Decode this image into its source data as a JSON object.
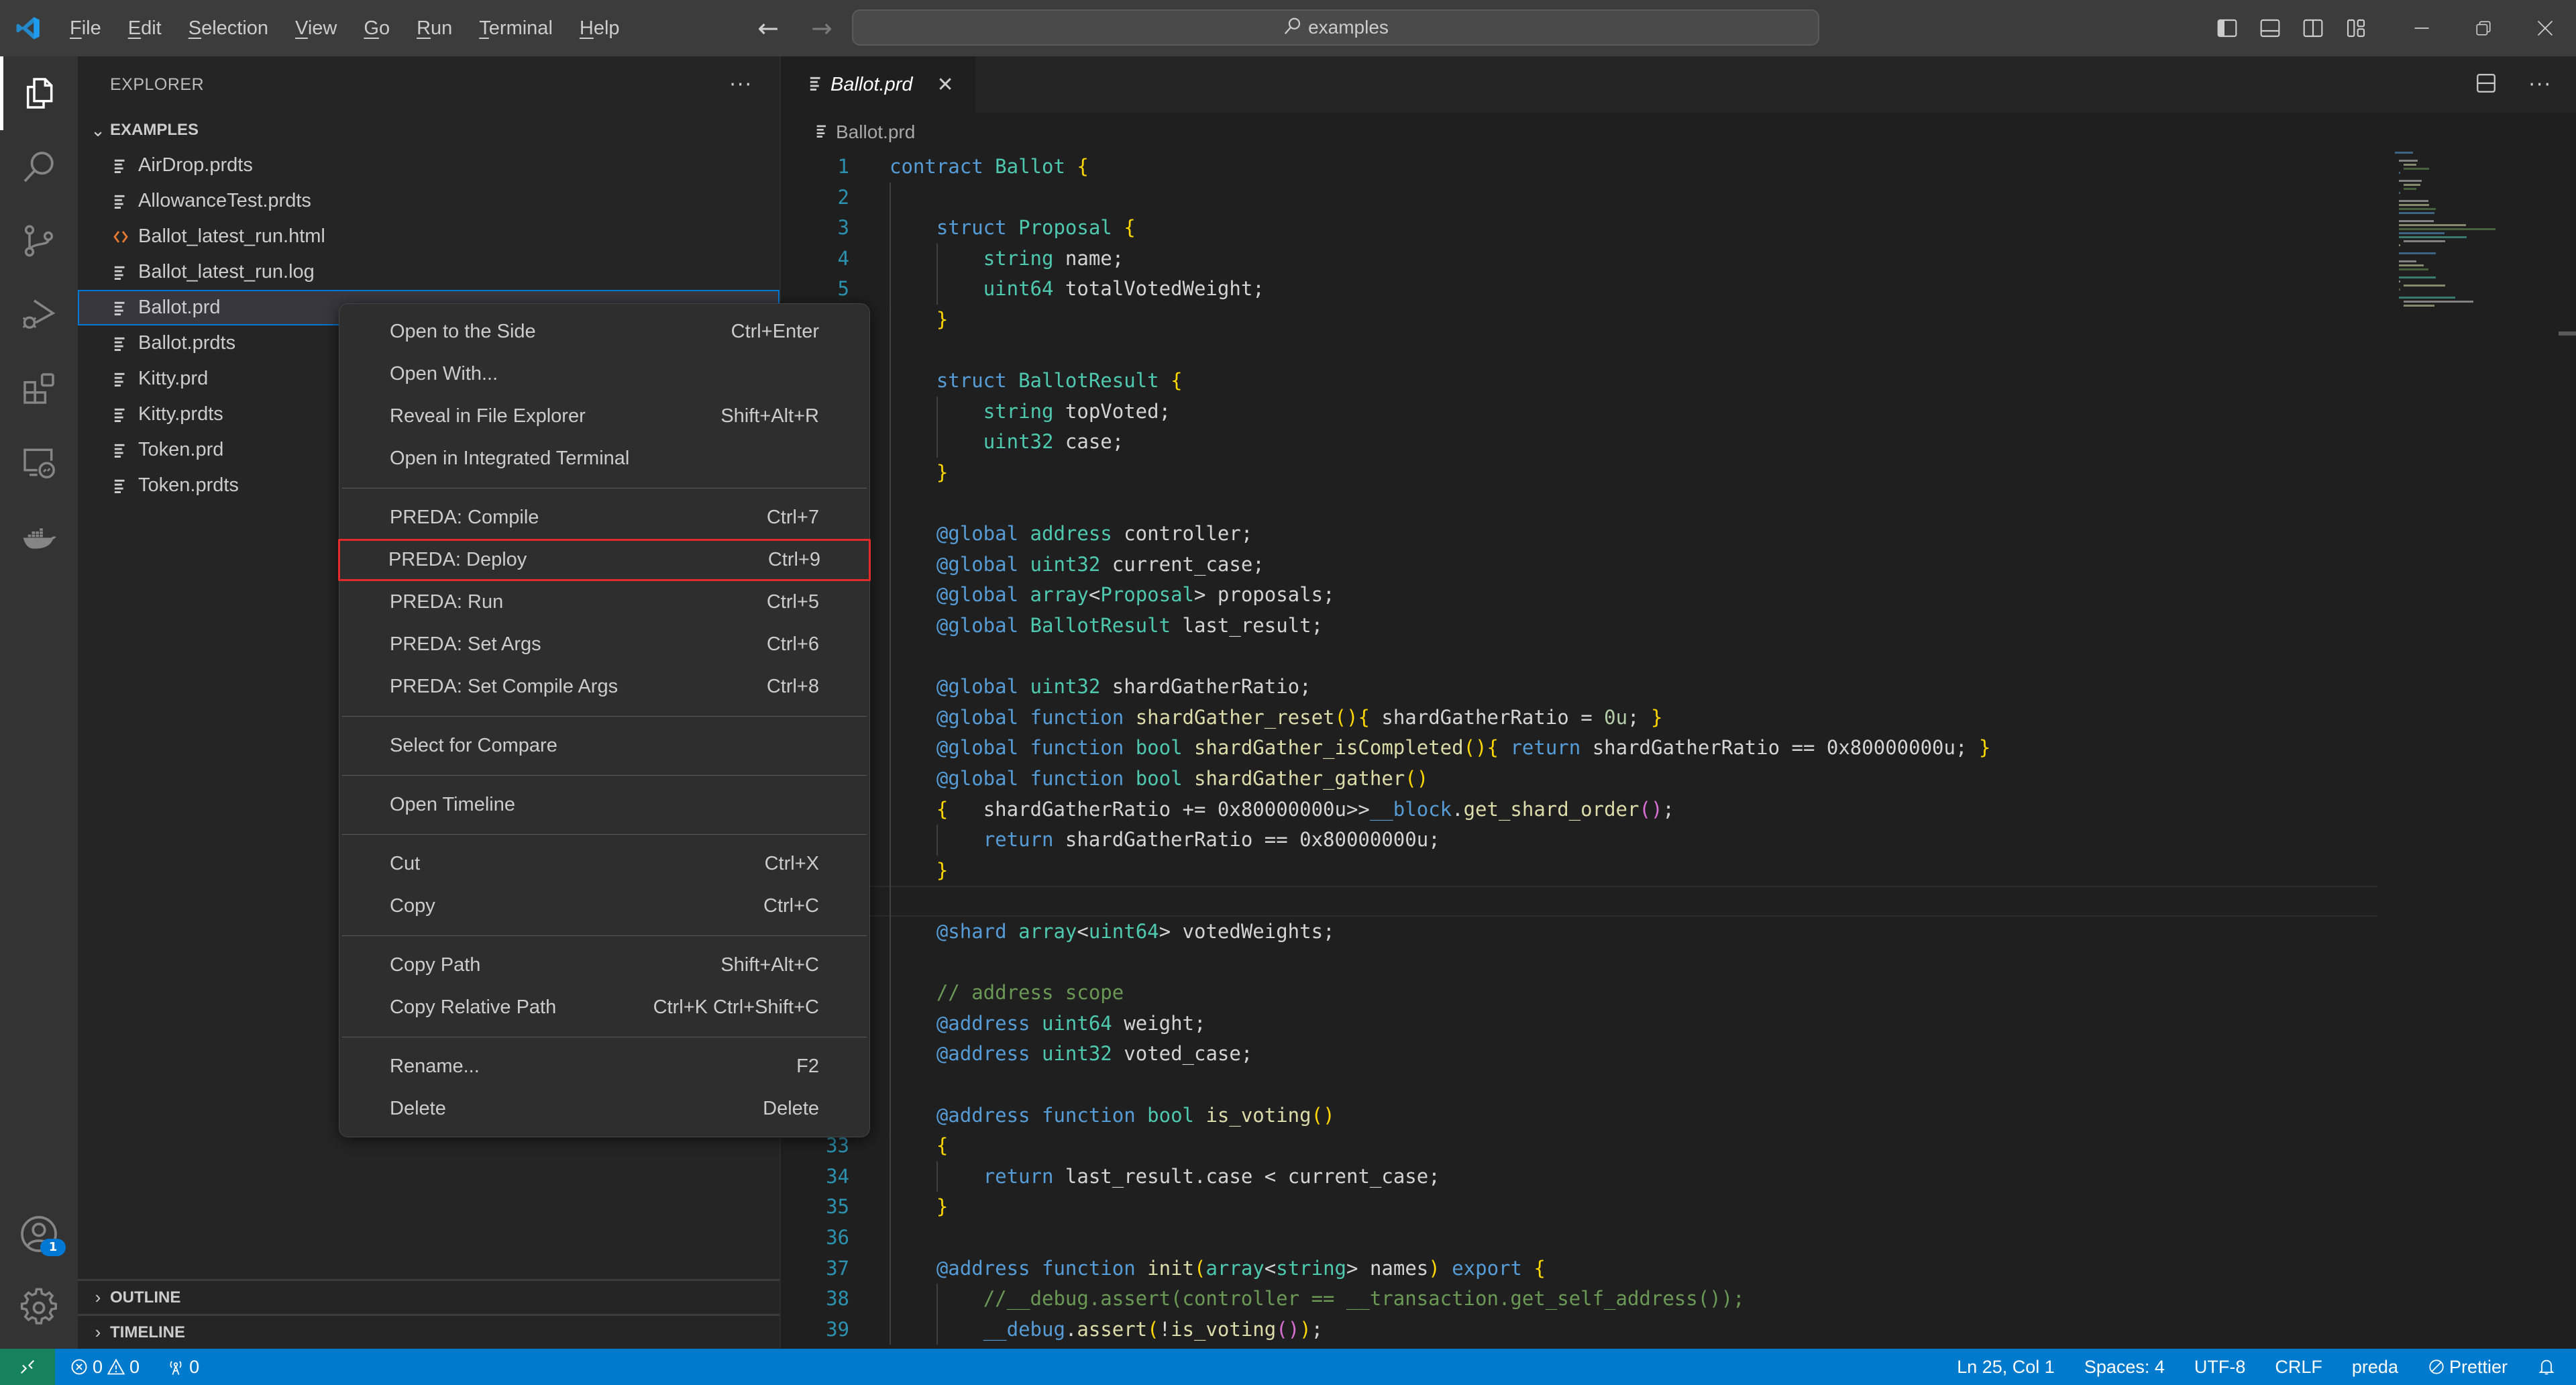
{
  "titlebar": {
    "menu": [
      {
        "label": "File",
        "mnemonic": "F",
        "rest": "ile"
      },
      {
        "label": "Edit",
        "mnemonic": "E",
        "rest": "dit"
      },
      {
        "label": "Selection",
        "mnemonic": "S",
        "rest": "election"
      },
      {
        "label": "View",
        "mnemonic": "V",
        "rest": "iew"
      },
      {
        "label": "Go",
        "mnemonic": "G",
        "rest": "o"
      },
      {
        "label": "Run",
        "mnemonic": "R",
        "rest": "un"
      },
      {
        "label": "Terminal",
        "mnemonic": "T",
        "rest": "erminal"
      },
      {
        "label": "Help",
        "mnemonic": "H",
        "rest": "elp"
      }
    ],
    "back_arrow": "←",
    "forward_arrow": "→",
    "search_text": "examples",
    "window_minimize": "—",
    "window_close": "✕"
  },
  "sidebar": {
    "title": "EXPLORER",
    "more": "···",
    "folder": "EXAMPLES",
    "files": [
      {
        "name": "AirDrop.prdts",
        "icon": "text-file-icon"
      },
      {
        "name": "AllowanceTest.prdts",
        "icon": "text-file-icon"
      },
      {
        "name": "Ballot_latest_run.html",
        "icon": "html-file-icon"
      },
      {
        "name": "Ballot_latest_run.log",
        "icon": "text-file-icon"
      },
      {
        "name": "Ballot.prd",
        "icon": "text-file-icon",
        "selected": true
      },
      {
        "name": "Ballot.prdts",
        "icon": "text-file-icon"
      },
      {
        "name": "Kitty.prd",
        "icon": "text-file-icon"
      },
      {
        "name": "Kitty.prdts",
        "icon": "text-file-icon"
      },
      {
        "name": "Token.prd",
        "icon": "text-file-icon"
      },
      {
        "name": "Token.prdts",
        "icon": "text-file-icon"
      }
    ],
    "outline": "OUTLINE",
    "timeline": "TIMELINE"
  },
  "activitybar": {
    "items": [
      "explorer",
      "search",
      "source-control",
      "run-debug",
      "extensions",
      "remote-explorer",
      "docker"
    ],
    "accounts_badge": "1"
  },
  "editor": {
    "tab": {
      "label": "Ballot.prd",
      "close": "✕"
    },
    "breadcrumb": "Ballot.prd",
    "visible_line_numbers": [
      1,
      2,
      3,
      4,
      5,
      33,
      34,
      35,
      36,
      37,
      38,
      39
    ],
    "lines": [
      "contract Ballot {",
      "",
      "    struct Proposal {",
      "        string name;",
      "        uint64 totalVotedWeight;",
      "    }",
      "",
      "    struct BallotResult {",
      "        string topVoted;",
      "        uint32 case;",
      "    }",
      "",
      "    @global address controller;",
      "    @global uint32 current_case;",
      "    @global array<Proposal> proposals;",
      "    @global BallotResult last_result;",
      "",
      "    @global uint32 shardGatherRatio;",
      "    @global function shardGather_reset(){ shardGatherRatio = 0u; }",
      "    @global function bool shardGather_isCompleted(){ return shardGatherRatio == 0x80000000u; }",
      "    @global function bool shardGather_gather()",
      "    {   shardGatherRatio += 0x80000000u>>__block.get_shard_order();",
      "        return shardGatherRatio == 0x80000000u;",
      "    }",
      "",
      "    @shard array<uint64> votedWeights;",
      "",
      "    // address scope",
      "    @address uint64 weight;",
      "    @address uint32 voted_case;",
      "",
      "    @address function bool is_voting()",
      "    {",
      "        return last_result.case < current_case;",
      "    }",
      "",
      "    @address function init(array<string> names) export {",
      "        //__debug.assert(controller == __transaction.get_self_address());",
      "        __debug.assert(!is_voting());"
    ],
    "current_line": 25
  },
  "context_menu": {
    "groups": [
      [
        {
          "label": "Open to the Side",
          "shortcut": "Ctrl+Enter"
        },
        {
          "label": "Open With...",
          "shortcut": ""
        },
        {
          "label": "Reveal in File Explorer",
          "shortcut": "Shift+Alt+R"
        },
        {
          "label": "Open in Integrated Terminal",
          "shortcut": ""
        }
      ],
      [
        {
          "label": "PREDA: Compile",
          "shortcut": "Ctrl+7"
        },
        {
          "label": "PREDA: Deploy",
          "shortcut": "Ctrl+9",
          "highlighted": true
        },
        {
          "label": "PREDA: Run",
          "shortcut": "Ctrl+5"
        },
        {
          "label": "PREDA: Set Args",
          "shortcut": "Ctrl+6"
        },
        {
          "label": "PREDA: Set Compile Args",
          "shortcut": "Ctrl+8"
        }
      ],
      [
        {
          "label": "Select for Compare",
          "shortcut": ""
        }
      ],
      [
        {
          "label": "Open Timeline",
          "shortcut": ""
        }
      ],
      [
        {
          "label": "Cut",
          "shortcut": "Ctrl+X"
        },
        {
          "label": "Copy",
          "shortcut": "Ctrl+C"
        }
      ],
      [
        {
          "label": "Copy Path",
          "shortcut": "Shift+Alt+C"
        },
        {
          "label": "Copy Relative Path",
          "shortcut": "Ctrl+K Ctrl+Shift+C"
        }
      ],
      [
        {
          "label": "Rename...",
          "shortcut": "F2"
        },
        {
          "label": "Delete",
          "shortcut": "Delete"
        }
      ]
    ]
  },
  "statusbar": {
    "errors": "0",
    "warnings": "0",
    "ports": "0",
    "position": "Ln 25, Col 1",
    "indent": "Spaces: 4",
    "encoding": "UTF-8",
    "eol": "CRLF",
    "language": "preda",
    "formatter": "Prettier"
  },
  "colors": {
    "accent": "#007acc",
    "remote": "#16825d",
    "highlight_border": "#e32b2b",
    "selection_border": "#0078d4"
  }
}
